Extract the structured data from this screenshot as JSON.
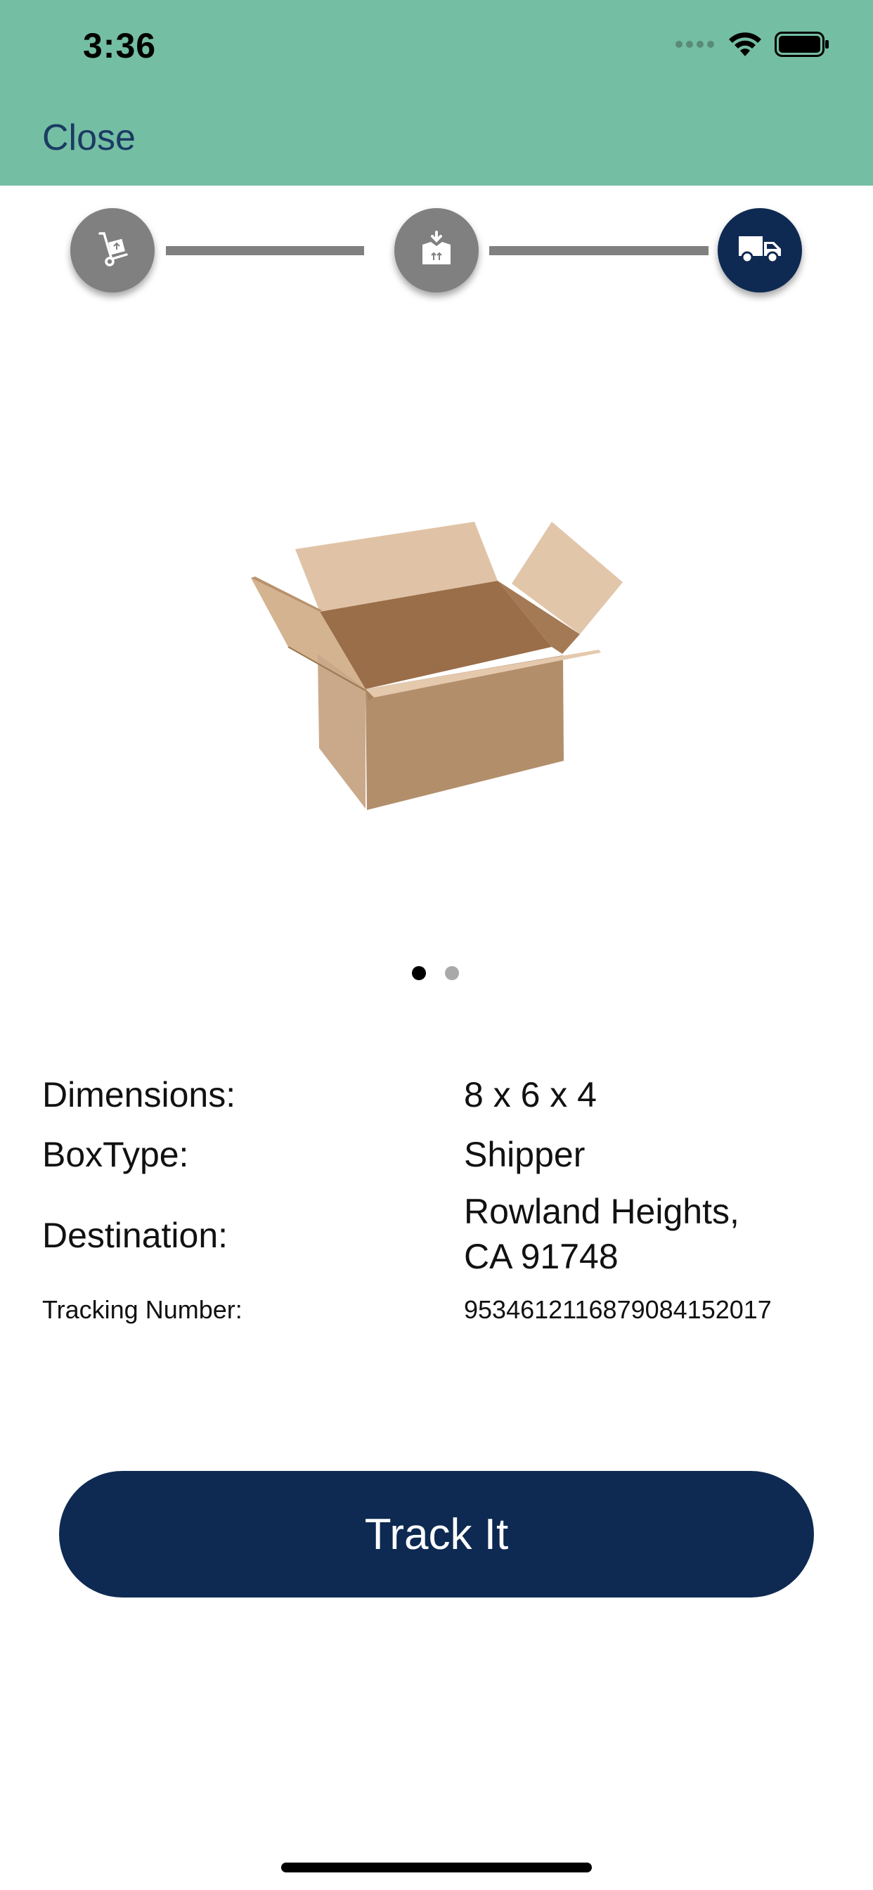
{
  "status_bar": {
    "time": "3:36",
    "icons": [
      "signal-icon",
      "wifi-icon",
      "battery-icon"
    ]
  },
  "nav": {
    "close_label": "Close"
  },
  "progress": {
    "steps": [
      {
        "icon": "hand-truck-icon",
        "state": "complete"
      },
      {
        "icon": "packed-box-icon",
        "state": "complete"
      },
      {
        "icon": "delivery-truck-icon",
        "state": "current"
      }
    ]
  },
  "pager": {
    "count": 2,
    "current": 1
  },
  "details": {
    "dimensions_label": "Dimensions:",
    "dimensions_value": "8 x 6 x 4",
    "boxtype_label": "BoxType:",
    "boxtype_value": "Shipper",
    "destination_label": "Destination:",
    "destination_line1": "Rowland Heights,",
    "destination_line2": "CA 91748",
    "tracking_label": "Tracking Number:",
    "tracking_value": "9534612116879084152017"
  },
  "actions": {
    "track_label": "Track It"
  },
  "colors": {
    "header": "#74bea4",
    "primary": "#0e2a52",
    "inactive_step": "#808080",
    "close_link": "#1b3b62"
  }
}
